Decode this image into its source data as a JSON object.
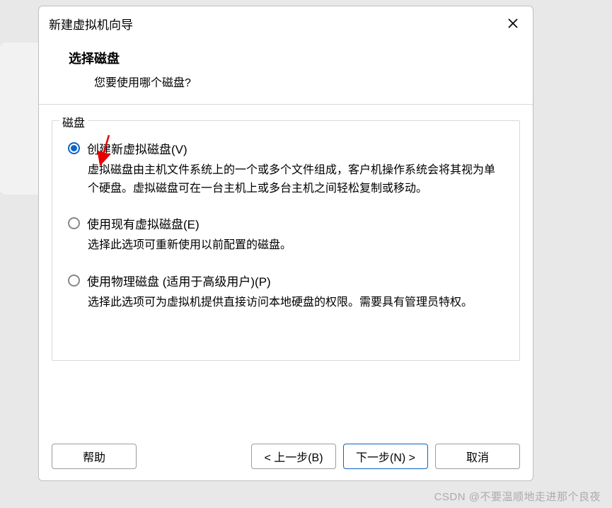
{
  "dialog": {
    "title": "新建虚拟机向导",
    "header": {
      "title": "选择磁盘",
      "subtitle": "您要使用哪个磁盘?"
    },
    "fieldset_legend": "磁盘",
    "options": [
      {
        "label": "创建新虚拟磁盘(V)",
        "description": "虚拟磁盘由主机文件系统上的一个或多个文件组成，客户机操作系统会将其视为单个硬盘。虚拟磁盘可在一台主机上或多台主机之间轻松复制或移动。",
        "selected": true
      },
      {
        "label": "使用现有虚拟磁盘(E)",
        "description": "选择此选项可重新使用以前配置的磁盘。",
        "selected": false
      },
      {
        "label": "使用物理磁盘 (适用于高级用户)(P)",
        "description": "选择此选项可为虚拟机提供直接访问本地硬盘的权限。需要具有管理员特权。",
        "selected": false
      }
    ],
    "buttons": {
      "help": "帮助",
      "back": "< 上一步(B)",
      "next": "下一步(N) >",
      "cancel": "取消"
    }
  },
  "watermark": "CSDN @不要温顺地走进那个良夜"
}
